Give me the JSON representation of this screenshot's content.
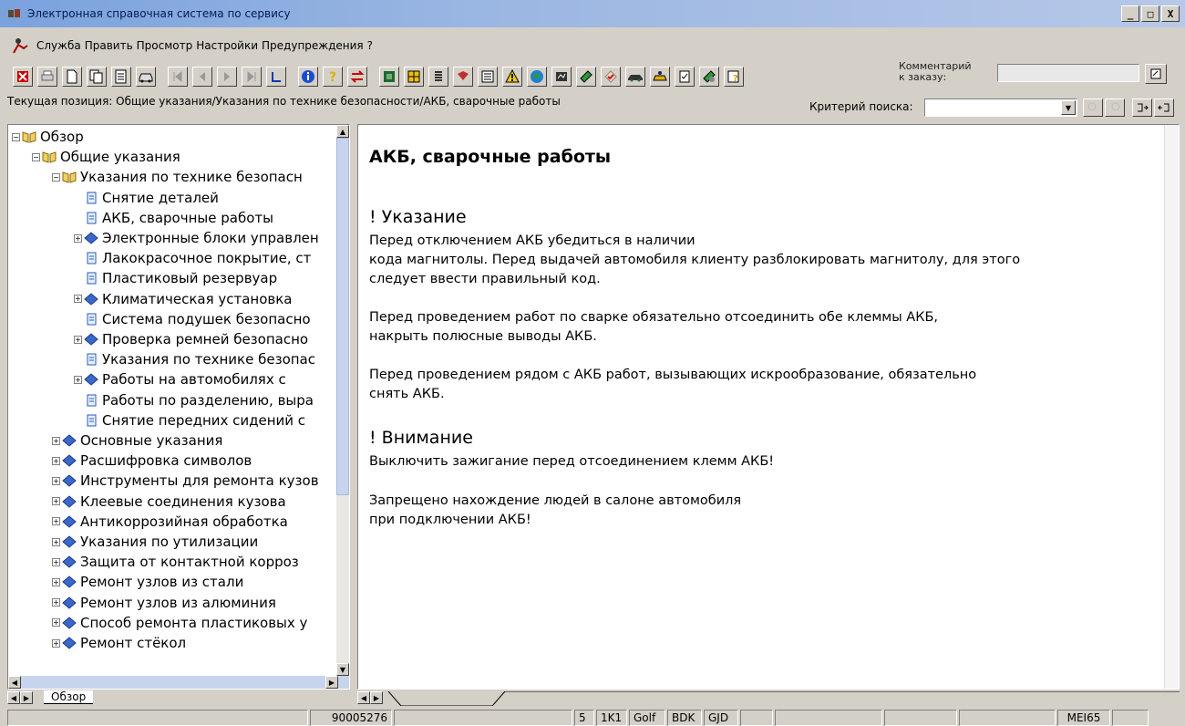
{
  "window": {
    "title": "Электронная справочная система по сервису",
    "controls": [
      "_",
      "□",
      "X"
    ]
  },
  "menu": {
    "items": [
      {
        "label": "Служба"
      },
      {
        "label": "Править"
      },
      {
        "label": "Просмотр"
      },
      {
        "label": "Настройки"
      },
      {
        "label": "Предупреждения"
      },
      {
        "label": "?"
      }
    ]
  },
  "toolbar": {
    "comment_label": "Комментарий\nк заказу:",
    "comment_value": ""
  },
  "path": {
    "label": "Текущая позиция: Общие указания/Указания по технике безопасности/АКБ, сварочные работы"
  },
  "search": {
    "label": "Критерий поиска:",
    "value": ""
  },
  "tree": {
    "items": [
      {
        "label": "Обзор"
      },
      {
        "label": "Общие указания"
      },
      {
        "label": "Указания по технике безопасн"
      },
      {
        "label": "Снятие деталей"
      },
      {
        "label": "АКБ, сварочные работы"
      },
      {
        "label": "Электронные блоки управлен"
      },
      {
        "label": "Лакокрасочное покрытие, ст"
      },
      {
        "label": "Пластиковый резервуар"
      },
      {
        "label": "Климатическая установка"
      },
      {
        "label": "Система подушек безопасно"
      },
      {
        "label": "Проверка ремней безопасно"
      },
      {
        "label": "Указания по технике безопас"
      },
      {
        "label": "Работы на автомобилях с"
      },
      {
        "label": "Работы по разделению, выра"
      },
      {
        "label": "Снятие передних сидений с"
      },
      {
        "label": "Основные указания"
      },
      {
        "label": "Расшифровка символов"
      },
      {
        "label": "Инструменты для ремонта кузов"
      },
      {
        "label": "Клеевые соединения кузова"
      },
      {
        "label": "Антикоррозийная обработка"
      },
      {
        "label": "Указания по утилизации"
      },
      {
        "label": "Защита от контактной корроз"
      },
      {
        "label": "Ремонт узлов из стали"
      },
      {
        "label": "Ремонт узлов из алюминия"
      },
      {
        "label": "Способ ремонта пластиковых у"
      },
      {
        "label": "Ремонт стёкол"
      }
    ],
    "tab_label": "Обзор"
  },
  "content": {
    "title": "АКБ, сварочные работы",
    "notice_head": "! Указание",
    "notice_p1_l1": "Перед отключением АКБ убедиться в наличии",
    "notice_p1_l2": "кода магнитолы. Перед выдачей автомобиля клиенту разблокировать магнитолу, для этого",
    "notice_p1_l3": "следует ввести правильный код.",
    "notice_p2_l1": "Перед проведением работ по сварке обязательно отсоединить обе клеммы АКБ,",
    "notice_p2_l2": "накрыть полюсные выводы АКБ.",
    "notice_p3_l1": "Перед проведением рядом с АКБ работ, вызывающих искрообразование, обязательно",
    "notice_p3_l2": "снять АКБ.",
    "warning_head": "! Внимание",
    "warning_p1": "Выключить зажигание перед отсоединением клемм АКБ!",
    "warning_p2_l1": "Запрещено нахождение людей в салоне автомобиля",
    "warning_p2_l2": "при подключении АКБ!"
  },
  "status": {
    "order": "90005276",
    "c1": "5",
    "c2": "1K1",
    "c3": "Golf",
    "c4": "BDK",
    "c5": "GJD",
    "c6": "MEI65"
  }
}
